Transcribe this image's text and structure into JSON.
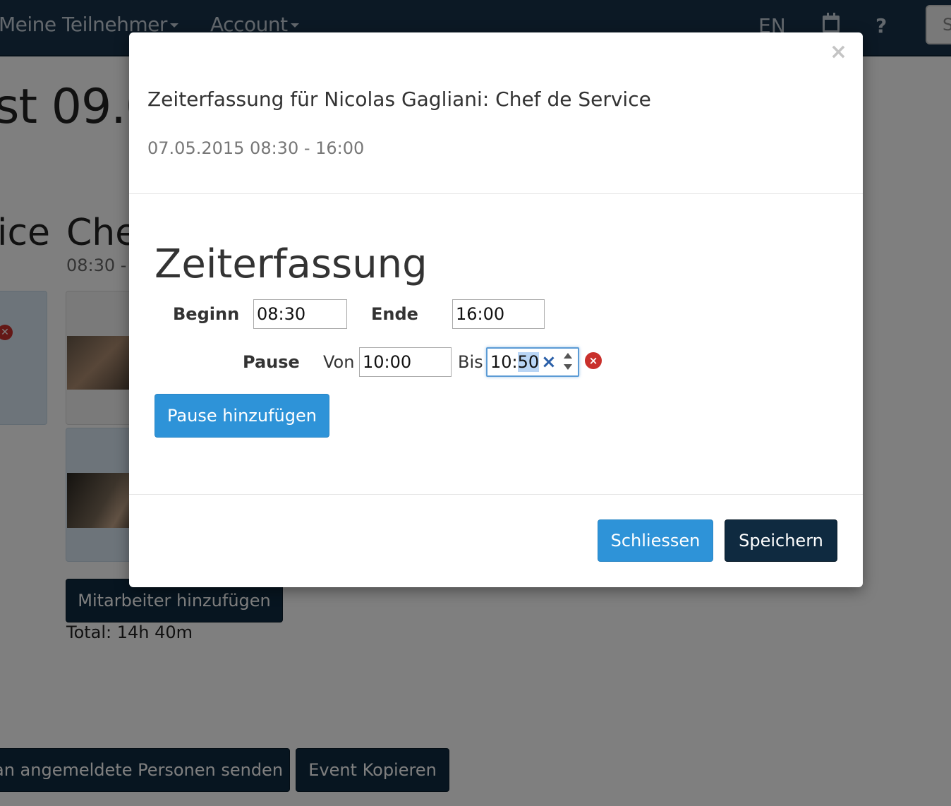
{
  "navbar": {
    "menu_participants": "Meine Teilnehmer",
    "menu_account": "Account",
    "lang": "EN",
    "help": "?",
    "search_partial": "S"
  },
  "background": {
    "page_title_partial": "st 09.0",
    "column_title_left_partial": "ice",
    "column_title_partial": "Che",
    "column_time_partial": "08:30 - 1",
    "add_employee_button": "Mitarbeiter hinzufügen",
    "total": "Total: 14h 40m",
    "send_button_partial": "an angemeldete Personen senden",
    "copy_event_button": "Event Kopieren"
  },
  "modal": {
    "close_symbol": "×",
    "title": "Zeiterfassung für Nicolas Gagliani: Chef de Service",
    "subtitle": "07.05.2015 08:30 - 16:00",
    "section_title": "Zeiterfassung",
    "begin_label": "Beginn",
    "begin_value": "08:30",
    "end_label": "Ende",
    "end_value": "16:00",
    "pause_label": "Pause",
    "from_label": "Von",
    "from_value": "10:00",
    "to_label": "Bis",
    "to_value_hours": "10:",
    "to_value_minutes": "50",
    "clear_symbol": "×",
    "remove_symbol": "×",
    "add_pause_button": "Pause hinzufügen",
    "close_button": "Schliessen",
    "save_button": "Speichern"
  },
  "colors": {
    "navbar": "#18334a",
    "primary_button": "#2e93d8",
    "dark_button": "#0f2a40",
    "remove": "#c9302c",
    "focus_border": "#5b9bd5"
  }
}
